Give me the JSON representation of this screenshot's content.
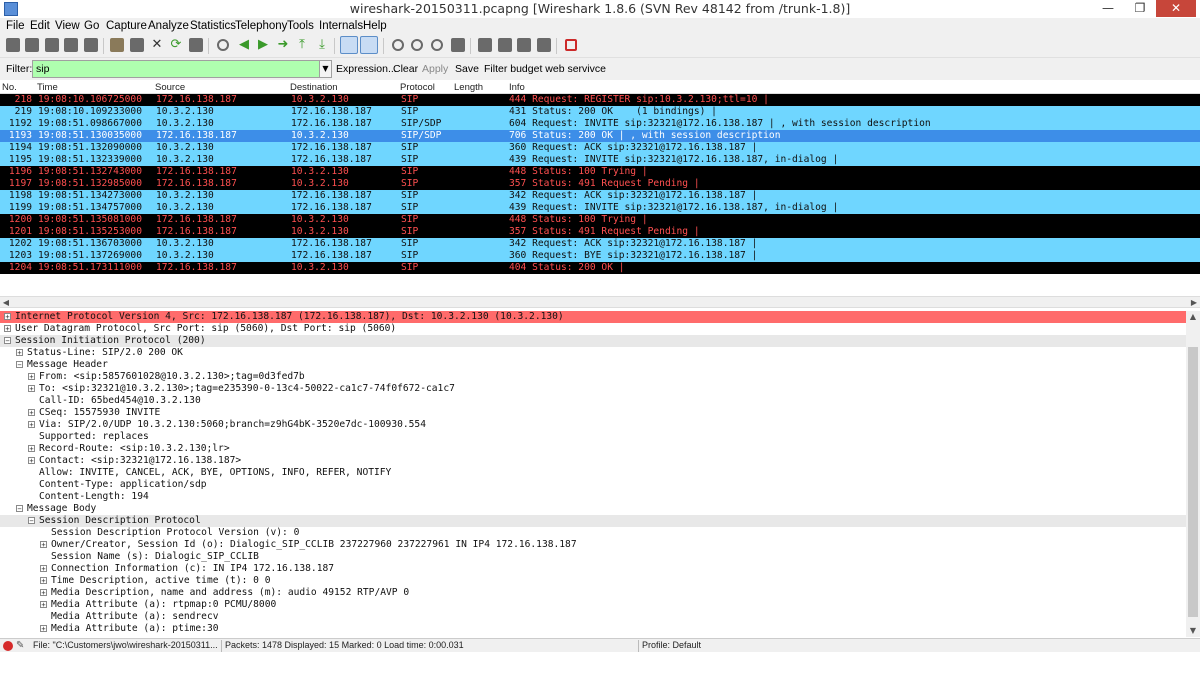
{
  "window": {
    "title": "wireshark-20150311.pcapng   [Wireshark 1.8.6  (SVN Rev 48142 from /trunk-1.8)]",
    "minimize": "—",
    "maximize": "❐",
    "close": "✕"
  },
  "menu": [
    "File",
    "Edit",
    "View",
    "Go",
    "Capture",
    "Analyze",
    "Statistics",
    "Telephony",
    "Tools",
    "Internals",
    "Help"
  ],
  "filter": {
    "label": "Filter:",
    "value": "sip",
    "expression": "Expression...",
    "clear": "Clear",
    "apply": "Apply",
    "save": "Save",
    "budget": "Filter budget web servivce"
  },
  "columns": [
    "No.",
    "Time",
    "Source",
    "Destination",
    "Protocol",
    "Length",
    "Info"
  ],
  "packets": [
    {
      "no": "218",
      "time": "19:08:10.106725000",
      "src": "172.16.138.187",
      "dst": "10.3.2.130",
      "proto": "SIP",
      "len": "",
      "info": "444 Request: REGISTER sip:10.3.2.130;ttl=10 |",
      "style": "blk"
    },
    {
      "no": "219",
      "time": "19:08:10.109233000",
      "src": "10.3.2.130",
      "dst": "172.16.138.187",
      "proto": "SIP",
      "len": "",
      "info": "431 Status: 200 OK    (1 bindings) |",
      "style": "cyn"
    },
    {
      "no": "1192",
      "time": "19:08:51.098667000",
      "src": "10.3.2.130",
      "dst": "172.16.138.187",
      "proto": "SIP/SDP",
      "len": "",
      "info": "604 Request: INVITE sip:32321@172.16.138.187 | , with session description",
      "style": "cyn"
    },
    {
      "no": "1193",
      "time": "19:08:51.130035000",
      "src": "172.16.138.187",
      "dst": "10.3.2.130",
      "proto": "SIP/SDP",
      "len": "",
      "info": "706 Status: 200 OK | , with session description",
      "style": "sel"
    },
    {
      "no": "1194",
      "time": "19:08:51.132090000",
      "src": "10.3.2.130",
      "dst": "172.16.138.187",
      "proto": "SIP",
      "len": "",
      "info": "360 Request: ACK sip:32321@172.16.138.187 |",
      "style": "cyn"
    },
    {
      "no": "1195",
      "time": "19:08:51.132339000",
      "src": "10.3.2.130",
      "dst": "172.16.138.187",
      "proto": "SIP",
      "len": "",
      "info": "439 Request: INVITE sip:32321@172.16.138.187, in-dialog |",
      "style": "cyn"
    },
    {
      "no": "1196",
      "time": "19:08:51.132743000",
      "src": "172.16.138.187",
      "dst": "10.3.2.130",
      "proto": "SIP",
      "len": "",
      "info": "448 Status: 100 Trying |",
      "style": "blk"
    },
    {
      "no": "1197",
      "time": "19:08:51.132985000",
      "src": "172.16.138.187",
      "dst": "10.3.2.130",
      "proto": "SIP",
      "len": "",
      "info": "357 Status: 491 Request Pending |",
      "style": "blk"
    },
    {
      "no": "1198",
      "time": "19:08:51.134273000",
      "src": "10.3.2.130",
      "dst": "172.16.138.187",
      "proto": "SIP",
      "len": "",
      "info": "342 Request: ACK sip:32321@172.16.138.187 |",
      "style": "cyn"
    },
    {
      "no": "1199",
      "time": "19:08:51.134757000",
      "src": "10.3.2.130",
      "dst": "172.16.138.187",
      "proto": "SIP",
      "len": "",
      "info": "439 Request: INVITE sip:32321@172.16.138.187, in-dialog |",
      "style": "cyn"
    },
    {
      "no": "1200",
      "time": "19:08:51.135081000",
      "src": "172.16.138.187",
      "dst": "10.3.2.130",
      "proto": "SIP",
      "len": "",
      "info": "448 Status: 100 Trying |",
      "style": "blk"
    },
    {
      "no": "1201",
      "time": "19:08:51.135253000",
      "src": "172.16.138.187",
      "dst": "10.3.2.130",
      "proto": "SIP",
      "len": "",
      "info": "357 Status: 491 Request Pending |",
      "style": "blk"
    },
    {
      "no": "1202",
      "time": "19:08:51.136703000",
      "src": "10.3.2.130",
      "dst": "172.16.138.187",
      "proto": "SIP",
      "len": "",
      "info": "342 Request: ACK sip:32321@172.16.138.187 |",
      "style": "cyn"
    },
    {
      "no": "1203",
      "time": "19:08:51.137269000",
      "src": "10.3.2.130",
      "dst": "172.16.138.187",
      "proto": "SIP",
      "len": "",
      "info": "360 Request: BYE sip:32321@172.16.138.187 |",
      "style": "cyn"
    },
    {
      "no": "1204",
      "time": "19:08:51.173111000",
      "src": "172.16.138.187",
      "dst": "10.3.2.130",
      "proto": "SIP",
      "len": "",
      "info": "404 Status: 200 OK |",
      "style": "blk"
    }
  ],
  "details": [
    {
      "indent": 0,
      "toggle": "+",
      "text": "Internet Protocol Version 4, Src: 172.16.138.187 (172.16.138.187), Dst: 10.3.2.130 (10.3.2.130)",
      "hl": "red"
    },
    {
      "indent": 0,
      "toggle": "+",
      "text": "User Datagram Protocol, Src Port: sip (5060), Dst Port: sip (5060)",
      "hl": ""
    },
    {
      "indent": 0,
      "toggle": "-",
      "text": "Session Initiation Protocol (200)",
      "hl": "gray"
    },
    {
      "indent": 1,
      "toggle": "+",
      "text": "Status-Line: SIP/2.0 200 OK",
      "hl": ""
    },
    {
      "indent": 1,
      "toggle": "-",
      "text": "Message Header",
      "hl": ""
    },
    {
      "indent": 2,
      "toggle": "+",
      "text": "From: <sip:5857601028@10.3.2.130>;tag=0d3fed7b",
      "hl": ""
    },
    {
      "indent": 2,
      "toggle": "+",
      "text": "To: <sip:32321@10.3.2.130>;tag=e235390-0-13c4-50022-ca1c7-74f0f672-ca1c7",
      "hl": ""
    },
    {
      "indent": 2,
      "toggle": "",
      "text": "Call-ID: 65bed454@10.3.2.130",
      "hl": ""
    },
    {
      "indent": 2,
      "toggle": "+",
      "text": "CSeq: 15575930 INVITE",
      "hl": ""
    },
    {
      "indent": 2,
      "toggle": "+",
      "text": "Via: SIP/2.0/UDP 10.3.2.130:5060;branch=z9hG4bK-3520e7dc-100930.554",
      "hl": ""
    },
    {
      "indent": 2,
      "toggle": "",
      "text": "Supported: replaces",
      "hl": ""
    },
    {
      "indent": 2,
      "toggle": "+",
      "text": "Record-Route: <sip:10.3.2.130;lr>",
      "hl": ""
    },
    {
      "indent": 2,
      "toggle": "+",
      "text": "Contact: <sip:32321@172.16.138.187>",
      "hl": ""
    },
    {
      "indent": 2,
      "toggle": "",
      "text": "Allow: INVITE, CANCEL, ACK, BYE, OPTIONS, INFO, REFER, NOTIFY",
      "hl": ""
    },
    {
      "indent": 2,
      "toggle": "",
      "text": "Content-Type: application/sdp",
      "hl": ""
    },
    {
      "indent": 2,
      "toggle": "",
      "text": "Content-Length: 194",
      "hl": ""
    },
    {
      "indent": 1,
      "toggle": "-",
      "text": "Message Body",
      "hl": ""
    },
    {
      "indent": 2,
      "toggle": "-",
      "text": "Session Description Protocol",
      "hl": "gray"
    },
    {
      "indent": 3,
      "toggle": "",
      "text": "Session Description Protocol Version (v): 0",
      "hl": ""
    },
    {
      "indent": 3,
      "toggle": "+",
      "text": "Owner/Creator, Session Id (o): Dialogic_SIP_CCLIB 237227960 237227961 IN IP4 172.16.138.187",
      "hl": ""
    },
    {
      "indent": 3,
      "toggle": "",
      "text": "Session Name (s): Dialogic_SIP_CCLIB",
      "hl": ""
    },
    {
      "indent": 3,
      "toggle": "+",
      "text": "Connection Information (c): IN IP4 172.16.138.187",
      "hl": ""
    },
    {
      "indent": 3,
      "toggle": "+",
      "text": "Time Description, active time (t): 0 0",
      "hl": ""
    },
    {
      "indent": 3,
      "toggle": "+",
      "text": "Media Description, name and address (m): audio 49152 RTP/AVP 0",
      "hl": ""
    },
    {
      "indent": 3,
      "toggle": "+",
      "text": "Media Attribute (a): rtpmap:0 PCMU/8000",
      "hl": ""
    },
    {
      "indent": 3,
      "toggle": "",
      "text": "Media Attribute (a): sendrecv",
      "hl": ""
    },
    {
      "indent": 3,
      "toggle": "+",
      "text": "Media Attribute (a): ptime:30",
      "hl": ""
    }
  ],
  "status": {
    "file": "File: \"C:\\Customers\\jwo\\wireshark-20150311...",
    "packets": "Packets: 1478 Displayed: 15 Marked: 0 Load time: 0:00.031",
    "profile": "Profile: Default"
  },
  "colors": {
    "selected": "#3d8ee8",
    "sip_request_bg": "#6fd6ff",
    "sip_error_bg": "#000000",
    "sip_error_fg": "#ff5050",
    "filter_ok": "#afffaf"
  }
}
